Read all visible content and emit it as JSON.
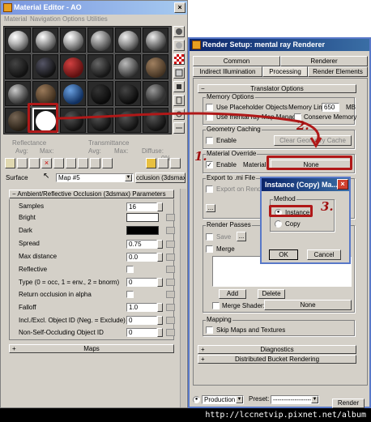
{
  "material_editor": {
    "title": "Material Editor - AO",
    "menu": [
      "Material",
      "Navigation",
      "Options",
      "Utilities"
    ],
    "reflectance": {
      "label": "Reflectance",
      "avg": "Avg:",
      "max": "Max:"
    },
    "transmittance": {
      "label": "Transmittance",
      "avg": "Avg:",
      "max": "Max:",
      "diffuse": "Diffuse:",
      "diffuse_value": "0%"
    },
    "surface_label": "Surface",
    "map_name": "Map #5",
    "map_type": "cclusion (3dsmax)",
    "rollout_title": "Ambient/Reflective Occlusion (3dsmax) Parameters",
    "params": [
      {
        "label": "Samples",
        "value": "16",
        "kind": "spin"
      },
      {
        "label": "Bright",
        "value": "",
        "kind": "color-white"
      },
      {
        "label": "Dark",
        "value": "",
        "kind": "color-black"
      },
      {
        "label": "Spread",
        "value": "0.75",
        "kind": "spin"
      },
      {
        "label": "Max distance",
        "value": "0.0",
        "kind": "spin"
      },
      {
        "label": "Reflective",
        "value": "",
        "kind": "check"
      },
      {
        "label": "Type (0 = occ, 1 = env., 2 = bnorm)",
        "value": "0",
        "kind": "spin"
      },
      {
        "label": "Return occlusion in alpha",
        "value": "",
        "kind": "check"
      },
      {
        "label": "Falloff",
        "value": "1.0",
        "kind": "spin"
      },
      {
        "label": "Incl./Excl. Object ID (Neg. = Exclude)",
        "value": "0",
        "kind": "spin"
      },
      {
        "label": "Non-Self-Occluding Object ID",
        "value": "0",
        "kind": "spin"
      }
    ],
    "maps_rollout": "Maps"
  },
  "render_setup": {
    "title": "Render Setup: mental ray Renderer",
    "tabs_row1": [
      "Common",
      "Renderer"
    ],
    "tabs_row2": [
      "Indirect Illumination",
      "Processing",
      "Render Elements"
    ],
    "rollout_translator": "Translator Options",
    "memory_options": {
      "title": "Memory Options",
      "use_placeholder": "Use Placeholder Objects",
      "memory_limit_label": "Memory Limit:",
      "memory_limit_value": "650",
      "unit": "MB",
      "use_mental_ray_map_manager": "Use mental ray Map Manager",
      "conserve_memory": "Conserve Memory"
    },
    "geometry_caching": {
      "title": "Geometry Caching",
      "enable": "Enable",
      "clear_button": "Clear Geometry Cache"
    },
    "material_override": {
      "title": "Material Override",
      "enable": "Enable",
      "material_label": "Material:",
      "material_value": "None"
    },
    "export_mi": {
      "title": "Export to .mi File",
      "export_on_render": "Export on Render"
    },
    "render_passes": {
      "title": "Render Passes",
      "save": "Save",
      "merge": "Merge",
      "add": "Add",
      "delete": "Delete",
      "merge_shader": "Merge Shader:",
      "merge_shader_value": "None"
    },
    "mapping": {
      "title": "Mapping",
      "skip": "Skip Maps and Textures"
    },
    "rollout_diagnostics": "Diagnostics",
    "rollout_distributed": "Distributed Bucket Rendering",
    "bottom": {
      "mode": "Production",
      "preset_label": "Preset:",
      "preset_value": "------------------",
      "render_button": "Render"
    }
  },
  "dialog": {
    "title": "Instance (Copy) Ma...",
    "method_label": "Method",
    "instance": "Instance",
    "copy": "Copy",
    "ok": "OK",
    "cancel": "Cancel"
  },
  "annotations": {
    "step1": "1.",
    "step2": "2.",
    "step3": "3."
  },
  "watermark": "http://lccnetvip.pixnet.net/album",
  "colors": {
    "title_active": "#0a246a",
    "title_inactive": "#7a96df",
    "annotation_red": "#b01818",
    "window_bg": "#d4d0c8"
  }
}
